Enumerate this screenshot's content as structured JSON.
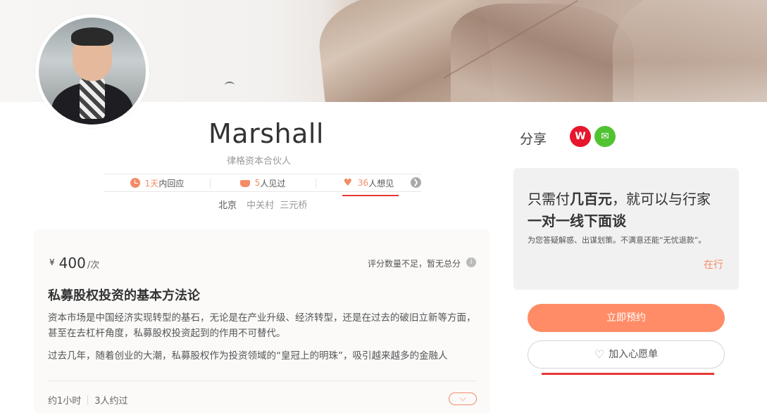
{
  "profile": {
    "name": "Marshall",
    "title": "律格资本合伙人",
    "avatar_icon": "person-photo"
  },
  "stats": [
    {
      "num": "1天",
      "label": "内回应",
      "icon": "clock-icon"
    },
    {
      "num": "5",
      "label": "人见过",
      "icon": "coffee-cup-icon"
    },
    {
      "num": "36",
      "label": "人想见",
      "icon": "heart-icon"
    }
  ],
  "stats_arrow": "❯",
  "location": {
    "city": "北京",
    "area1": "中关村",
    "area2": "三元桥"
  },
  "topic_card": {
    "currency": "¥",
    "price": "400",
    "unit": "/次",
    "rating_text": "评分数量不足，暂无总分",
    "info_icon": "i",
    "title": "私募股权投资的基本方法论",
    "paragraph1": "资本市场是中国经济实现转型的基石，无论是在产业升级、经济转型，还是在过去的破旧立新等方面，甚至在去杠杆角度，私募股权投资起到的作用不可替代。",
    "paragraph2": "过去几年，随着创业的大潮，私募股权作为投资领域的“皇冠上的明珠”，吸引越来越多的金融人",
    "duration": "约1小时",
    "met_count": "3人约过",
    "expand_icon": "⌵"
  },
  "share": {
    "label": "分享",
    "weibo_icon": "weibo-icon",
    "wechat_icon": "wechat-icon"
  },
  "promo": {
    "line1_pre": "只需付",
    "line1_bold": "几百元",
    "line1_post": "，就可以与行家",
    "line2": "一对一线下面谈",
    "line3": "为您答疑解惑、出谋划策。不满意还能“无忧退款”。",
    "line4": "在行"
  },
  "actions": {
    "book_label": "立即预约",
    "wish_label": "加入心愿单"
  },
  "colors": {
    "accent": "#f38c68",
    "button": "#ff8c66",
    "weibo": "#e6162d",
    "wechat": "#51c332",
    "underline": "#e53935"
  }
}
